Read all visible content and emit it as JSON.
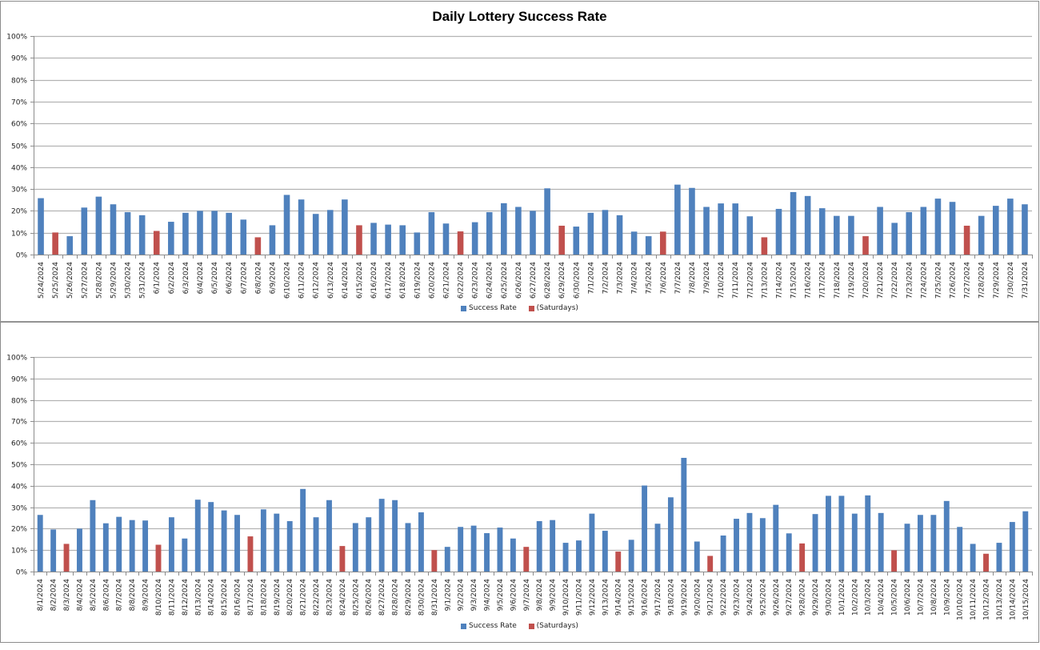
{
  "colors": {
    "success": "#4f81bd",
    "saturday": "#c0504d",
    "grid": "#b3b3b3",
    "axis": "#8c8c8c"
  },
  "chart_data": [
    {
      "type": "bar",
      "title": "Daily Lottery Success Rate",
      "xlabel": "",
      "ylabel": "",
      "ylim": [
        0,
        100
      ],
      "yticks": [
        "0%",
        "10%",
        "20%",
        "30%",
        "40%",
        "50%",
        "60%",
        "70%",
        "80%",
        "90%",
        "100%"
      ],
      "grid": true,
      "legend_position": "bottom",
      "legend": [
        "Success Rate",
        "(Saturdays)"
      ],
      "categories": [
        "5/24/2024",
        "5/25/2024",
        "5/26/2024",
        "5/27/2024",
        "5/28/2024",
        "5/29/2024",
        "5/30/2024",
        "5/31/2024",
        "6/1/2024",
        "6/2/2024",
        "6/3/2024",
        "6/4/2024",
        "6/5/2024",
        "6/6/2024",
        "6/7/2024",
        "6/8/2024",
        "6/9/2024",
        "6/10/2024",
        "6/11/2024",
        "6/12/2024",
        "6/13/2024",
        "6/14/2024",
        "6/15/2024",
        "6/16/2024",
        "6/17/2024",
        "6/18/2024",
        "6/19/2024",
        "6/20/2024",
        "6/21/2024",
        "6/22/2024",
        "6/23/2024",
        "6/24/2024",
        "6/25/2024",
        "6/26/2024",
        "6/27/2024",
        "6/28/2024",
        "6/29/2024",
        "6/30/2024",
        "7/1/2024",
        "7/2/2024",
        "7/3/2024",
        "7/4/2024",
        "7/5/2024",
        "7/6/2024",
        "7/7/2024",
        "7/8/2024",
        "7/9/2024",
        "7/10/2024",
        "7/11/2024",
        "7/12/2024",
        "7/13/2024",
        "7/14/2024",
        "7/15/2024",
        "7/16/2024",
        "7/17/2024",
        "7/18/2024",
        "7/19/2024",
        "7/20/2024",
        "7/21/2024",
        "7/22/2024",
        "7/23/2024",
        "7/24/2024",
        "7/25/2024",
        "7/26/2024",
        "7/27/2024",
        "7/28/2024",
        "7/29/2024",
        "7/30/2024",
        "7/31/2024"
      ],
      "values": [
        25.8,
        10.1,
        8.4,
        21.5,
        26.5,
        23.0,
        19.4,
        18.0,
        10.8,
        15.0,
        19.1,
        20.0,
        20.0,
        19.1,
        16.0,
        7.9,
        13.4,
        27.3,
        25.2,
        18.6,
        20.4,
        25.2,
        13.4,
        14.5,
        13.7,
        13.4,
        10.1,
        19.4,
        14.2,
        10.6,
        14.8,
        19.4,
        23.5,
        21.8,
        20.0,
        30.3,
        13.2,
        12.8,
        19.1,
        20.4,
        18.0,
        10.5,
        8.4,
        10.5,
        32.0,
        30.5,
        21.8,
        23.4,
        23.4,
        17.5,
        7.9,
        20.9,
        28.6,
        26.8,
        21.2,
        17.7,
        17.7,
        8.4,
        21.8,
        14.5,
        19.4,
        21.8,
        25.6,
        24.1,
        13.2,
        17.7,
        22.3,
        25.6,
        23.0
      ],
      "saturday_flags": [
        0,
        1,
        0,
        0,
        0,
        0,
        0,
        0,
        1,
        0,
        0,
        0,
        0,
        0,
        0,
        1,
        0,
        0,
        0,
        0,
        0,
        0,
        1,
        0,
        0,
        0,
        0,
        0,
        0,
        1,
        0,
        0,
        0,
        0,
        0,
        0,
        1,
        0,
        0,
        0,
        0,
        0,
        0,
        1,
        0,
        0,
        0,
        0,
        0,
        0,
        1,
        0,
        0,
        0,
        0,
        0,
        0,
        1,
        0,
        0,
        0,
        0,
        0,
        0,
        1,
        0,
        0,
        0,
        0
      ],
      "series": [
        {
          "name": "Success Rate",
          "color": "#4f81bd"
        },
        {
          "name": "(Saturdays)",
          "color": "#c0504d"
        }
      ]
    },
    {
      "type": "bar",
      "title": "",
      "xlabel": "",
      "ylabel": "",
      "ylim": [
        0,
        100
      ],
      "yticks": [
        "0%",
        "10%",
        "20%",
        "30%",
        "40%",
        "50%",
        "60%",
        "70%",
        "80%",
        "90%",
        "100%"
      ],
      "grid": true,
      "legend_position": "bottom",
      "legend": [
        "Success Rate",
        "(Saturdays)"
      ],
      "categories": [
        "8/1/2024",
        "8/2/2024",
        "8/3/2024",
        "8/4/2024",
        "8/5/2024",
        "8/6/2024",
        "8/7/2024",
        "8/8/2024",
        "8/9/2024",
        "8/10/2024",
        "8/11/2024",
        "8/12/2024",
        "8/13/2024",
        "8/14/2024",
        "8/15/2024",
        "8/16/2024",
        "8/17/2024",
        "8/18/2024",
        "8/19/2024",
        "8/20/2024",
        "8/21/2024",
        "8/22/2024",
        "8/23/2024",
        "8/24/2024",
        "8/25/2024",
        "8/26/2024",
        "8/27/2024",
        "8/28/2024",
        "8/29/2024",
        "8/30/2024",
        "8/31/2024",
        "9/1/2024",
        "9/2/2024",
        "9/3/2024",
        "9/4/2024",
        "9/5/2024",
        "9/6/2024",
        "9/7/2024",
        "9/8/2024",
        "9/9/2024",
        "9/10/2024",
        "9/11/2024",
        "9/12/2024",
        "9/13/2024",
        "9/14/2024",
        "9/15/2024",
        "9/16/2024",
        "9/17/2024",
        "9/18/2024",
        "9/19/2024",
        "9/20/2024",
        "9/21/2024",
        "9/22/2024",
        "9/23/2024",
        "9/24/2024",
        "9/25/2024",
        "9/26/2024",
        "9/27/2024",
        "9/28/2024",
        "9/29/2024",
        "9/30/2024",
        "10/1/2024",
        "10/2/2024",
        "10/3/2024",
        "10/4/2024",
        "10/5/2024",
        "10/6/2024",
        "10/7/2024",
        "10/8/2024",
        "10/9/2024",
        "10/10/2024",
        "10/11/2024",
        "10/12/2024",
        "10/13/2024",
        "10/14/2024",
        "10/15/2024"
      ],
      "values": [
        26.4,
        19.6,
        12.9,
        20.0,
        33.3,
        22.5,
        25.5,
        24.0,
        23.8,
        12.5,
        25.3,
        15.4,
        33.5,
        32.4,
        28.5,
        26.4,
        16.4,
        29.0,
        27.0,
        23.5,
        38.5,
        25.3,
        33.3,
        11.9,
        22.6,
        25.3,
        33.9,
        33.3,
        22.6,
        27.6,
        10.0,
        11.5,
        20.8,
        21.4,
        17.9,
        20.5,
        15.4,
        11.5,
        23.5,
        24.0,
        13.4,
        14.5,
        27.0,
        19.0,
        9.3,
        14.8,
        40.1,
        22.3,
        34.6,
        53.0,
        14.0,
        7.3,
        16.8,
        24.6,
        27.3,
        24.9,
        31.1,
        17.8,
        13.1,
        26.8,
        35.3,
        35.3,
        27.0,
        35.5,
        27.3,
        9.9,
        22.3,
        26.4,
        26.4,
        32.9,
        20.8,
        12.9,
        8.3,
        13.4,
        23.1,
        28.1
      ],
      "saturday_flags": [
        0,
        0,
        1,
        0,
        0,
        0,
        0,
        0,
        0,
        1,
        0,
        0,
        0,
        0,
        0,
        0,
        1,
        0,
        0,
        0,
        0,
        0,
        0,
        1,
        0,
        0,
        0,
        0,
        0,
        0,
        1,
        0,
        0,
        0,
        0,
        0,
        0,
        1,
        0,
        0,
        0,
        0,
        0,
        0,
        1,
        0,
        0,
        0,
        0,
        0,
        0,
        1,
        0,
        0,
        0,
        0,
        0,
        0,
        1,
        0,
        0,
        0,
        0,
        0,
        0,
        1,
        0,
        0,
        0,
        0,
        0,
        0,
        1,
        0,
        0,
        0
      ],
      "series": [
        {
          "name": "Success Rate",
          "color": "#4f81bd"
        },
        {
          "name": "(Saturdays)",
          "color": "#c0504d"
        }
      ]
    }
  ]
}
